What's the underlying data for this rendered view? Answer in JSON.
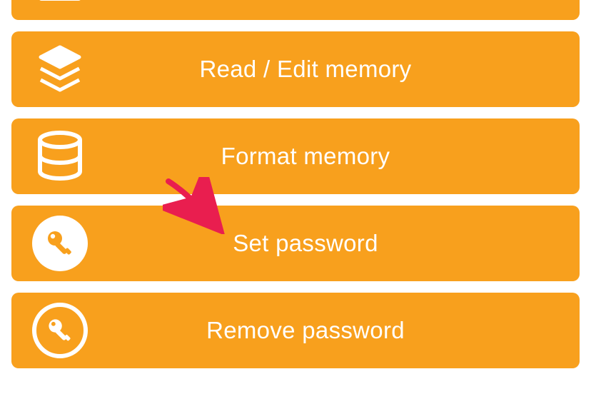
{
  "colors": {
    "accent": "#f8a01d",
    "text": "#ffffff",
    "arrow": "#e91e4f"
  },
  "menu": {
    "items": [
      {
        "icon": "upload-icon",
        "label": ""
      },
      {
        "icon": "layers-icon",
        "label": "Read / Edit memory"
      },
      {
        "icon": "database-icon",
        "label": "Format memory"
      },
      {
        "icon": "key-filled-icon",
        "label": "Set password"
      },
      {
        "icon": "key-outline-icon",
        "label": "Remove password"
      }
    ]
  },
  "annotation": {
    "type": "arrow",
    "target": "set-password-button"
  }
}
